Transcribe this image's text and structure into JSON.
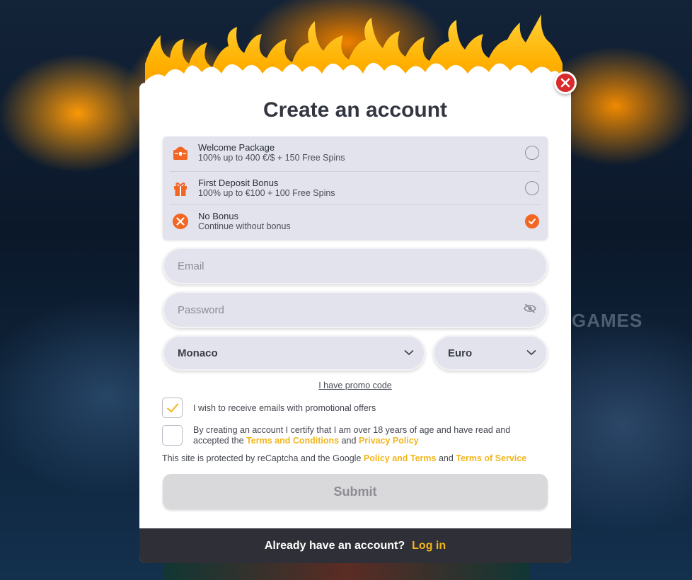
{
  "background": {
    "watermark": "GAMES"
  },
  "modal": {
    "title": "Create an account",
    "bonuses": [
      {
        "name": "Welcome Package",
        "desc": "100% up to 400 €/$ + 150 Free Spins",
        "icon": "chest-icon",
        "selected": false
      },
      {
        "name": "First Deposit Bonus",
        "desc": "100% up to €100 + 100 Free Spins",
        "icon": "gift-icon",
        "selected": false
      },
      {
        "name": "No Bonus",
        "desc": "Continue without bonus",
        "icon": "cancel-icon",
        "selected": true
      }
    ],
    "email_placeholder": "Email",
    "password_placeholder": "Password",
    "country": "Monaco",
    "currency": "Euro",
    "promo_link": "I have promo code",
    "checkbox_emails": "I wish to receive emails with promotional offers",
    "terms_prefix": "By creating an account I certify that I am over 18 years of age and have read and accepted the",
    "terms_link": "Terms and Conditions",
    "and_word": "and",
    "privacy_link": "Privacy Policy",
    "recaptcha_prefix": "This site is protected by reCaptcha and the Google",
    "recaptcha_policy_link": "Policy and Terms",
    "recaptcha_and": "and",
    "recaptcha_tos_link": "Terms of Service",
    "submit_label": "Submit",
    "footer_text": "Already have an account?",
    "footer_login": "Log in"
  },
  "colors": {
    "accent": "#f26522",
    "link": "#f3b51b",
    "close": "#d92b2b"
  }
}
